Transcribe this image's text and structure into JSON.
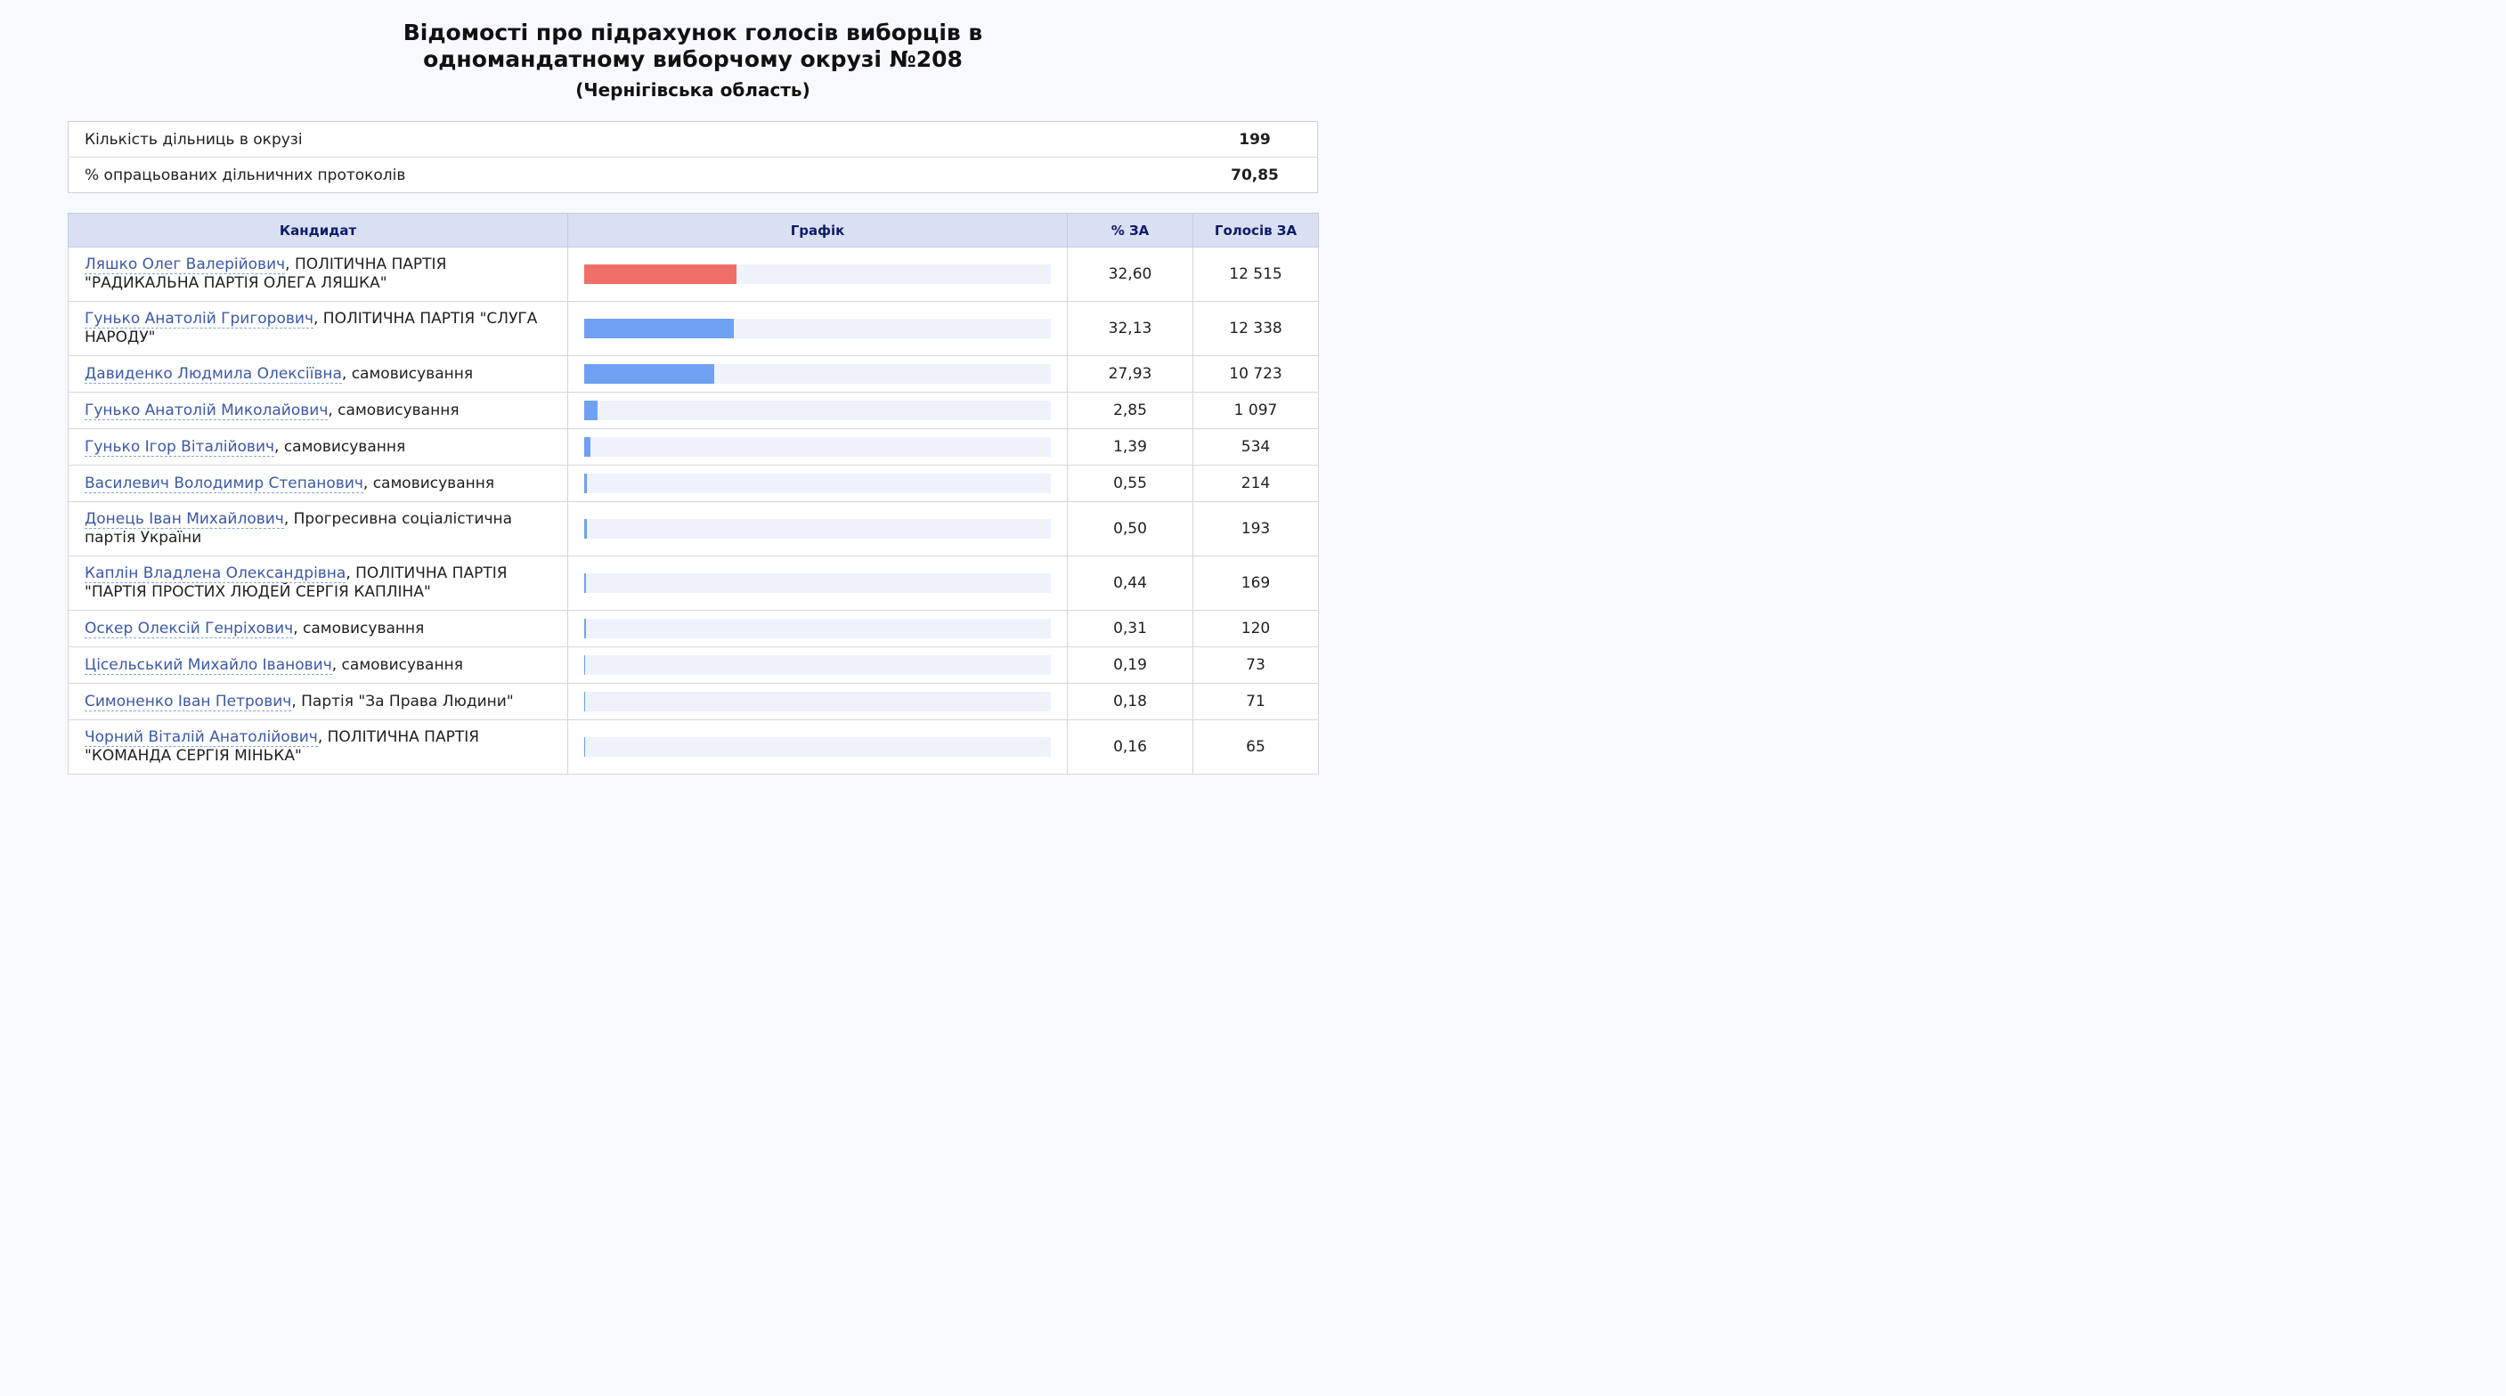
{
  "header": {
    "title": "Відомості про підрахунок голосів виборців в одномандатному виборчому окрузі №208",
    "subtitle": "(Чернігівська область)"
  },
  "summary": [
    {
      "label": "Кількість дільниць в окрузі",
      "value": "199"
    },
    {
      "label": "% опрацьованих дільничних протоколів",
      "value": "70,85"
    }
  ],
  "columns": {
    "candidate": "Кандидат",
    "chart": "Графік",
    "percent": "% ЗА",
    "votes": "Голосів ЗА"
  },
  "colors": {
    "leader_bar": "#ee6f68",
    "bar": "#6fa1f2",
    "track": "#eef2fb",
    "link": "#3b58a8",
    "header_bg": "#d9e0f2"
  },
  "candidates": [
    {
      "name": "Ляшко Олег Валерійович",
      "party": ", ПОЛІТИЧНА ПАРТІЯ \"РАДИКАЛЬНА ПАРТІЯ ОЛЕГА ЛЯШКА\"",
      "percent": "32,60",
      "votes": "12 515",
      "share": 32.6
    },
    {
      "name": "Гунько Анатолій Григорович",
      "party": ", ПОЛІТИЧНА ПАРТІЯ \"СЛУГА НАРОДУ\"",
      "percent": "32,13",
      "votes": "12 338",
      "share": 32.13
    },
    {
      "name": "Давиденко Людмила Олексіївна",
      "party": ", самовисування",
      "percent": "27,93",
      "votes": "10 723",
      "share": 27.93
    },
    {
      "name": "Гунько Анатолій Миколайович",
      "party": ", самовисування",
      "percent": "2,85",
      "votes": "1 097",
      "share": 2.85
    },
    {
      "name": "Гунько Ігор Віталійович",
      "party": ", самовисування",
      "percent": "1,39",
      "votes": "534",
      "share": 1.39
    },
    {
      "name": "Василевич Володимир Степанович",
      "party": ", самовисування",
      "percent": "0,55",
      "votes": "214",
      "share": 0.55
    },
    {
      "name": "Донець Іван Михайлович",
      "party": ", Прогресивна соціалістична партія України",
      "percent": "0,50",
      "votes": "193",
      "share": 0.5
    },
    {
      "name": "Каплін Владлена Олександрівна",
      "party": ", ПОЛІТИЧНА ПАРТІЯ \"ПАРТІЯ ПРОСТИХ ЛЮДЕЙ СЕРГІЯ КАПЛІНА\"",
      "percent": "0,44",
      "votes": "169",
      "share": 0.44
    },
    {
      "name": "Оскер Олексій Генріхович",
      "party": ", самовисування",
      "percent": "0,31",
      "votes": "120",
      "share": 0.31
    },
    {
      "name": "Цісельський Михайло Іванович",
      "party": ", самовисування",
      "percent": "0,19",
      "votes": "73",
      "share": 0.19
    },
    {
      "name": "Симоненко Іван Петрович",
      "party": ", Партія \"За Права Людини\"",
      "percent": "0,18",
      "votes": "71",
      "share": 0.18
    },
    {
      "name": "Чорний Віталій Анатолійович",
      "party": ", ПОЛІТИЧНА ПАРТІЯ \"КОМАНДА СЕРГІЯ МІНЬКА\"",
      "percent": "0,16",
      "votes": "65",
      "share": 0.16
    }
  ]
}
